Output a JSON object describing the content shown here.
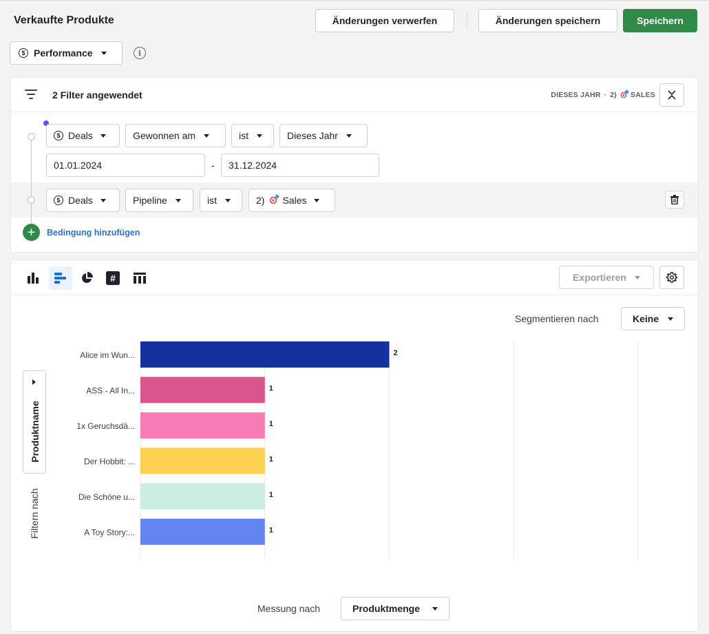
{
  "header": {
    "title": "Verkaufte Produkte",
    "discard_label": "Änderungen verwerfen",
    "save_changes_label": "Änderungen speichern",
    "save_label": "Speichern"
  },
  "report_type": {
    "icon": "dollar-circle-icon",
    "value": "Performance"
  },
  "filters": {
    "title": "2 Filter angewendet",
    "summary_period": "DIESES JAHR",
    "summary_pipeline_num": "2)",
    "summary_pipeline": "SALES",
    "conditions": [
      {
        "entity": "Deals",
        "field": "Gewonnen am",
        "operator": "ist",
        "value": "Dieses Jahr",
        "date_from": "01.01.2024",
        "date_to": "31.12.2024"
      },
      {
        "entity": "Deals",
        "field": "Pipeline",
        "operator": "ist",
        "value_num": "2)",
        "value": "Sales"
      }
    ],
    "add_condition_label": "Bedingung hinzufügen",
    "date_separator": "-"
  },
  "chart_toolbar": {
    "types": [
      "column-chart-icon",
      "bar-chart-icon",
      "pie-chart-icon",
      "number-icon",
      "table-icon"
    ],
    "active_type": "bar-chart-icon",
    "export_label": "Exportieren"
  },
  "segment": {
    "label": "Segmentieren nach",
    "value": "Keine"
  },
  "groupby": {
    "label": "Produktname",
    "filter_label": "Filtern nach"
  },
  "measure": {
    "label": "Messung nach",
    "value": "Produktmenge"
  },
  "chart_data": {
    "type": "bar",
    "orientation": "horizontal",
    "title": "",
    "xlabel": "",
    "ylabel": "Produktname",
    "categories": [
      "Alice im Wun...",
      "ASS - All In...",
      "1x Geruchsdä...",
      "Der Hobbit: ...",
      "Die Schöne u...",
      "A Toy Story:..."
    ],
    "values": [
      2,
      1,
      1,
      1,
      1,
      1
    ],
    "colors": [
      "#1233a0",
      "#d8568c",
      "#f97bb3",
      "#fecf50",
      "#ceede2",
      "#6285f2"
    ],
    "xlim": [
      0,
      4
    ],
    "xticks": [
      0,
      1,
      2,
      3,
      4
    ],
    "grid": true,
    "data_labels": true
  }
}
